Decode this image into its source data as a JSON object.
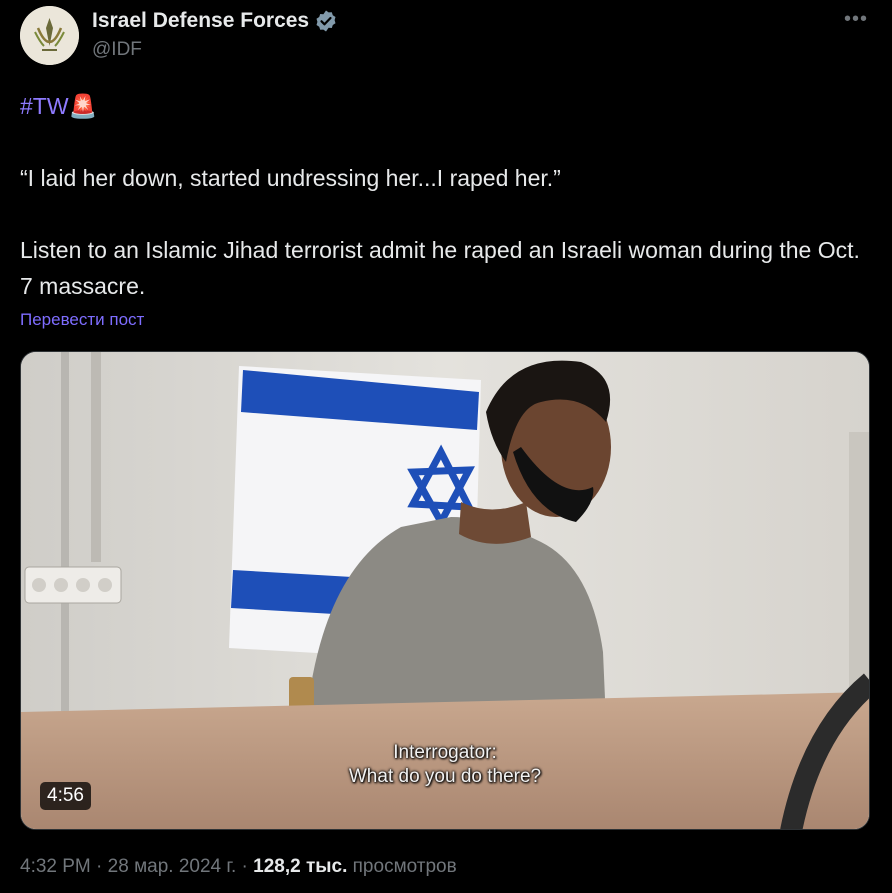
{
  "account": {
    "name": "Israel Defense Forces",
    "handle": "@IDF",
    "verified_color": "#829aab",
    "avatar_icon": "idf-emblem-icon"
  },
  "menu_icon": "more-horizontal-icon",
  "tweet": {
    "hashtag": "#TW",
    "hashtag_emoji": "🚨",
    "quote": "“I laid her down, started undressing her...I raped her.”",
    "body": "Listen to an Islamic Jihad terrorist admit he raped an Israeli woman during the Oct. 7 massacre.",
    "translate_label": "Перевести пост"
  },
  "video": {
    "caption_speaker": "Interrogator:",
    "caption_line": "What do you do there?",
    "duration": "4:56"
  },
  "meta": {
    "time": "4:32 PM",
    "separator": "·",
    "date": "28 мар. 2024 г.",
    "views_count": "128,2 тыс.",
    "views_label": "просмотров"
  },
  "colors": {
    "background": "#000000",
    "text": "#e7e9ea",
    "secondary_text": "#71767b",
    "link": "#8f7bff"
  }
}
